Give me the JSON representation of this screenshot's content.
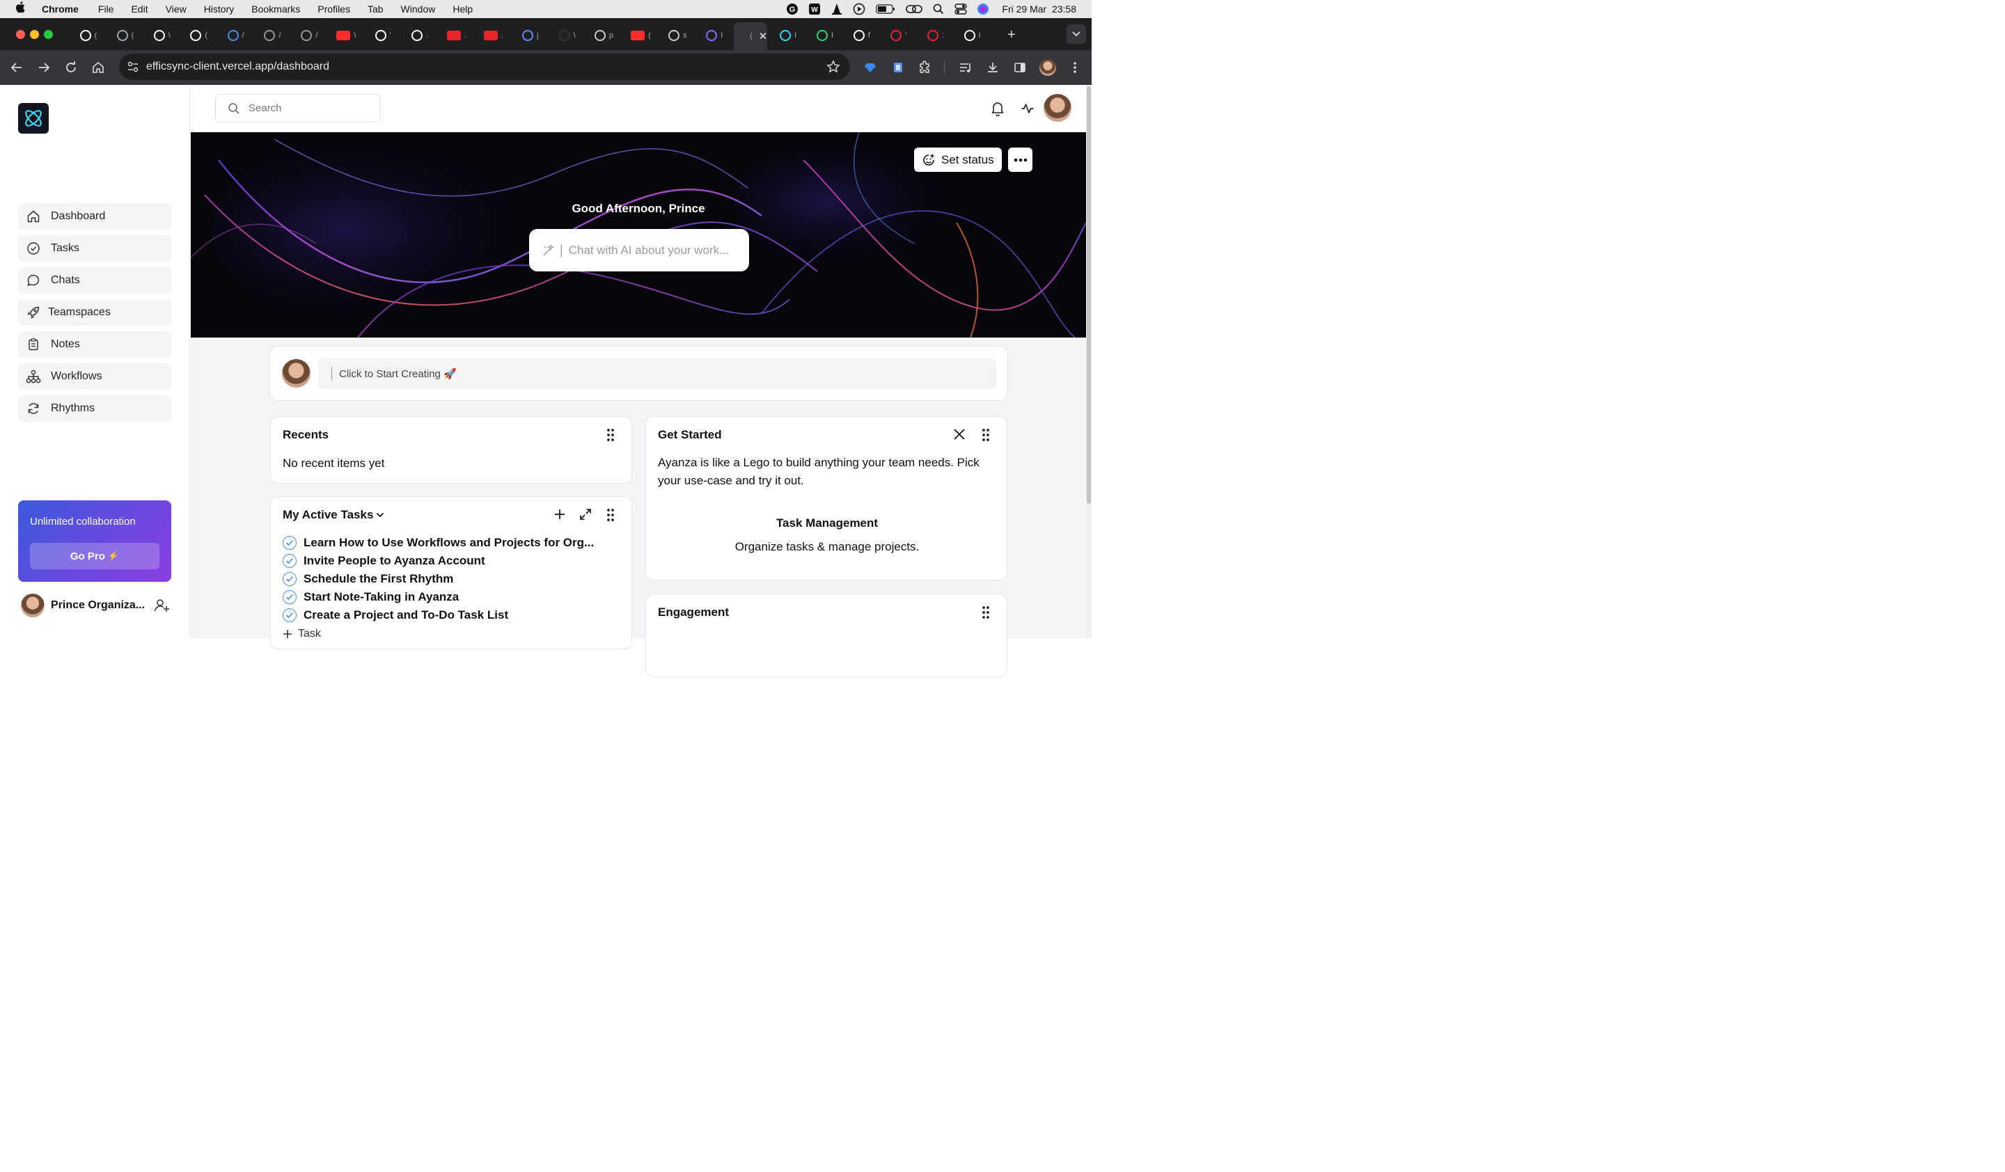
{
  "menubar": {
    "app_name": "Chrome",
    "items": [
      "File",
      "Edit",
      "View",
      "History",
      "Bookmarks",
      "Profiles",
      "Tab",
      "Window",
      "Help"
    ],
    "datetime": "Fri 29 Mar  23:58"
  },
  "browser": {
    "url": "efficsync-client.vercel.app/dashboard",
    "tabs": [
      {
        "icon": "github-icon",
        "label": "("
      },
      {
        "icon": "chatgpt-icon",
        "label": "("
      },
      {
        "icon": "gmail-icon",
        "label": "\\"
      },
      {
        "icon": "google-icon",
        "label": "("
      },
      {
        "icon": "safari-icon",
        "label": "/"
      },
      {
        "icon": "apple-icon",
        "label": "/"
      },
      {
        "icon": "apple-icon",
        "label": "/"
      },
      {
        "icon": "youtube-icon",
        "label": "\\"
      },
      {
        "icon": "j-logo-icon",
        "label": "'"
      },
      {
        "icon": "wl-logo-icon",
        "label": "."
      },
      {
        "icon": "j-red-icon",
        "label": "."
      },
      {
        "icon": "j-red-icon",
        "label": "."
      },
      {
        "icon": "rocket-icon",
        "label": "j"
      },
      {
        "icon": "vercel-icon",
        "label": "\\"
      },
      {
        "icon": "globe-icon",
        "label": "p"
      },
      {
        "icon": "youtube-icon",
        "label": "("
      },
      {
        "icon": "globe-icon",
        "label": "s"
      },
      {
        "icon": "bolt-icon",
        "label": "I"
      },
      {
        "icon": "active-page-icon",
        "label": "("
      },
      {
        "icon": "app-logo-icon",
        "label": "I"
      },
      {
        "icon": "green-arrow-icon",
        "label": "I"
      },
      {
        "icon": "google-icon",
        "label": "f"
      },
      {
        "icon": "r-logo-icon",
        "label": "'"
      },
      {
        "icon": "r-logo-icon",
        "label": ":"
      },
      {
        "icon": "triangle-icon",
        "label": "I"
      }
    ]
  },
  "sidebar": {
    "items": [
      {
        "label": "Dashboard",
        "icon": "home-icon"
      },
      {
        "label": "Tasks",
        "icon": "check-circle-icon"
      },
      {
        "label": "Chats",
        "icon": "chat-bubble-icon"
      },
      {
        "label": "Teamspaces",
        "icon": "rocket-icon"
      },
      {
        "label": "Notes",
        "icon": "clipboard-icon"
      },
      {
        "label": "Workflows",
        "icon": "workflow-icon"
      },
      {
        "label": "Rhythms",
        "icon": "refresh-icon"
      }
    ],
    "promo": {
      "text": "Unlimited collaboration",
      "button": "Go Pro",
      "button_emoji": "⚡"
    },
    "user": {
      "name": "Prince Organiza..."
    }
  },
  "topbar": {
    "search_placeholder": "Search"
  },
  "hero": {
    "set_status_label": "Set status",
    "greeting": "Good Afternoon, Prince",
    "ai_placeholder": "Chat with AI about your work..."
  },
  "composer": {
    "placeholder": "Click to Start Creating 🚀"
  },
  "recents": {
    "title": "Recents",
    "empty_text": "No recent items yet"
  },
  "active_tasks": {
    "title": "My Active Tasks",
    "tasks": [
      "Learn How to Use Workflows and Projects for Org...",
      "Invite People to Ayanza Account",
      "Schedule the First Rhythm",
      "Start Note-Taking in Ayanza",
      "Create a Project and To-Do Task List"
    ],
    "add_task_label": "Task"
  },
  "get_started": {
    "title": "Get Started",
    "description": "Ayanza is like a Lego to build anything your team needs. Pick your use-case and try it out.",
    "feature_title": "Task Management",
    "feature_desc": "Organize tasks & manage projects."
  },
  "engagement": {
    "title": "Engagement"
  }
}
